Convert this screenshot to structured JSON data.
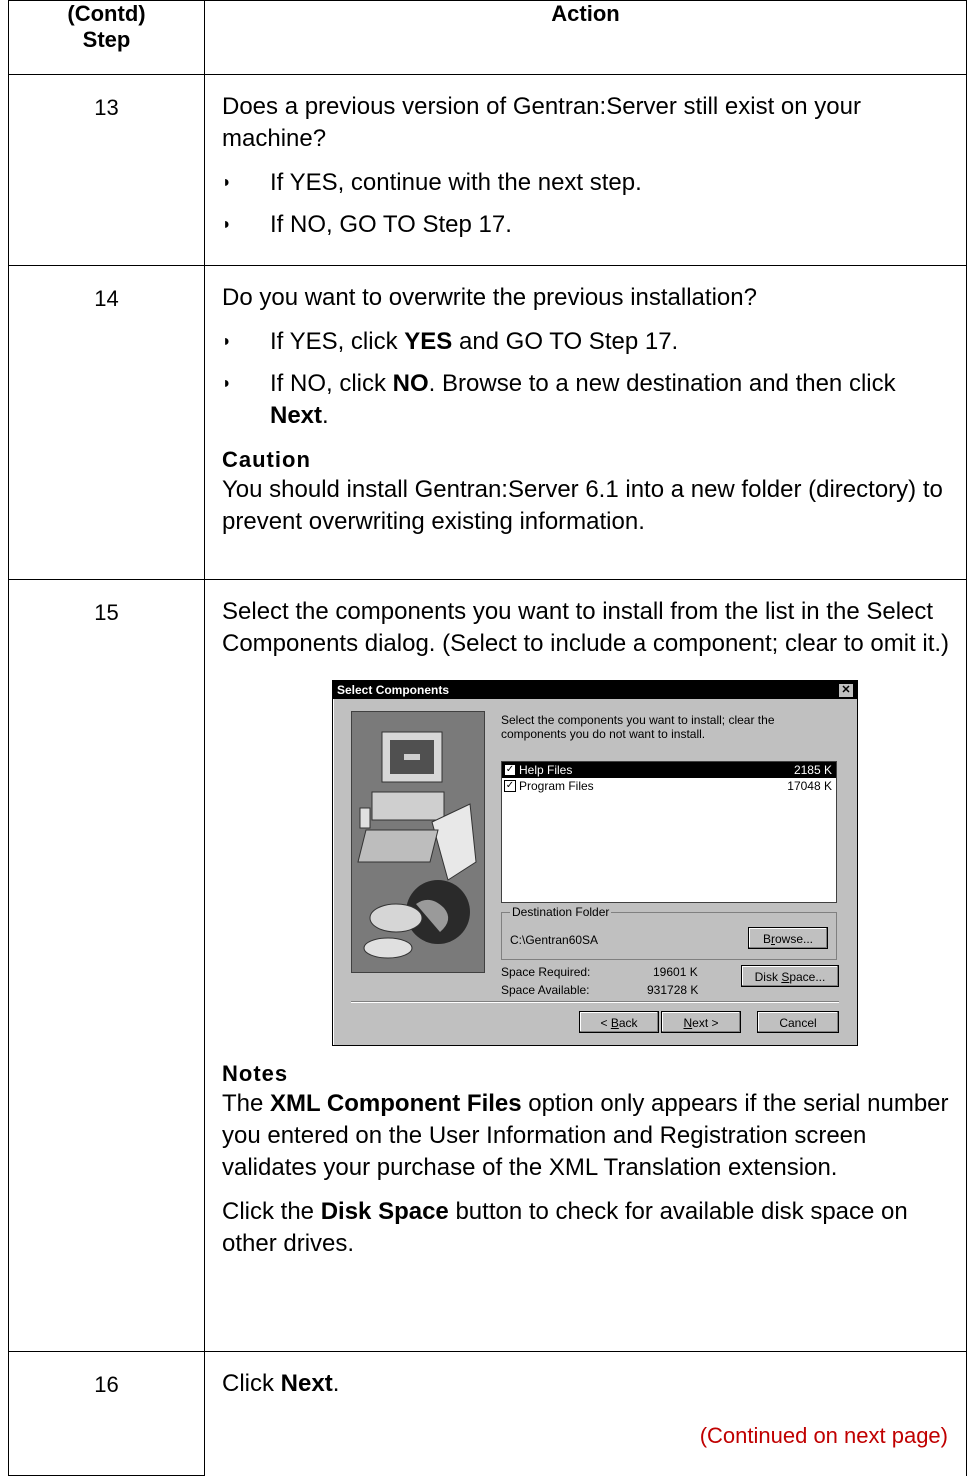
{
  "header": {
    "step_line1": "(Contd)",
    "step_line2": "Step",
    "action": "Action"
  },
  "rows": [
    {
      "step": "13",
      "question": "Does a previous version of Gentran:Server still exist on your machine?",
      "bullets": [
        "If YES, continue with the next step.",
        "If NO, GO TO Step 17."
      ]
    },
    {
      "step": "14",
      "question": "Do you want to overwrite the previous installation?",
      "b1_pre": "If YES, click ",
      "b1_bold": "YES",
      "b1_post": " and GO TO Step 17.",
      "b2_pre": "If NO, click ",
      "b2_bold": "NO",
      "b2_mid": ". Browse to a new destination and then click ",
      "b2_bold2": "Next",
      "b2_post": ".",
      "caution_title": "Caution",
      "caution_text": "You should install Gentran:Server 6.1 into a new folder (directory) to prevent overwriting existing information."
    },
    {
      "step": "15",
      "text": "Select the components you want to install from the list in the Select Components dialog. (Select to include a component; clear to omit it.)",
      "notes_title": "Notes",
      "note1_pre": "The ",
      "note1_bold": "XML Component Files",
      "note1_post": " option only appears if the serial number you entered on the User Information and Registration screen validates your purchase of the XML Translation extension.",
      "note2_pre": "Click the ",
      "note2_bold": "Disk Space",
      "note2_post": " button to check for available disk space on other drives."
    },
    {
      "step": "16",
      "pre": "Click ",
      "bold": "Next",
      "post": ".",
      "continued": "(Continued on next page)"
    }
  ],
  "dialog": {
    "title": "Select Components",
    "close": "✕",
    "intro": "Select the components you want to install; clear the components you do not want to install.",
    "components": [
      {
        "name": "Help Files",
        "size": "2185 K",
        "checked": true,
        "selected": true
      },
      {
        "name": "Program Files",
        "size": "17048 K",
        "checked": true,
        "selected": false
      }
    ],
    "destination_label": "Destination Folder",
    "destination_path": "C:\\Gentran60SA",
    "browse_pre": "B",
    "browse_u": "r",
    "browse_post": "owse...",
    "space_required_label": "Space Required:",
    "space_required_value": "19601 K",
    "space_available_label": "Space Available:",
    "space_available_value": "931728 K",
    "disk_pre": "Disk ",
    "disk_u": "S",
    "disk_post": "pace...",
    "back_pre": "< ",
    "back_u": "B",
    "back_post": "ack",
    "next_u": "N",
    "next_post": "ext >",
    "cancel": "Cancel"
  }
}
